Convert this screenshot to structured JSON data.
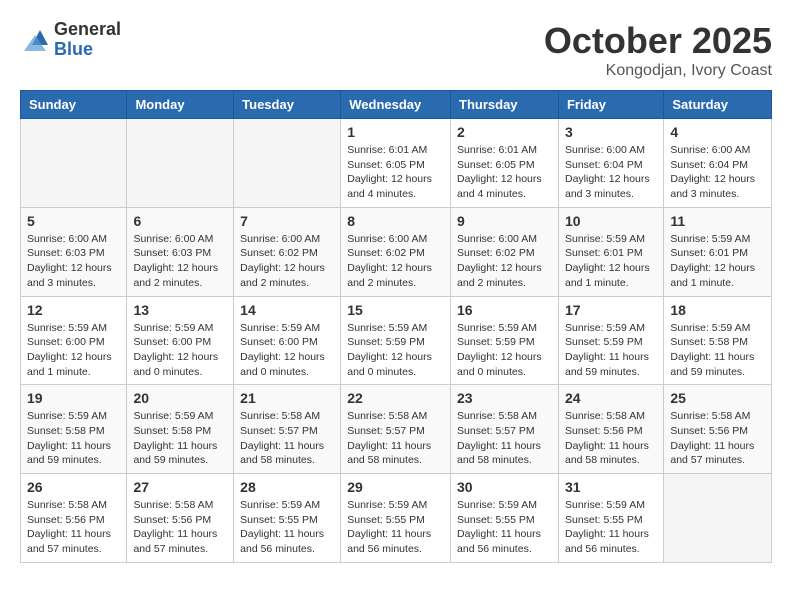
{
  "header": {
    "logo_general": "General",
    "logo_blue": "Blue",
    "month_title": "October 2025",
    "subtitle": "Kongodjan, Ivory Coast"
  },
  "days_of_week": [
    "Sunday",
    "Monday",
    "Tuesday",
    "Wednesday",
    "Thursday",
    "Friday",
    "Saturday"
  ],
  "weeks": [
    [
      {
        "day": "",
        "info": ""
      },
      {
        "day": "",
        "info": ""
      },
      {
        "day": "",
        "info": ""
      },
      {
        "day": "1",
        "info": "Sunrise: 6:01 AM\nSunset: 6:05 PM\nDaylight: 12 hours\nand 4 minutes."
      },
      {
        "day": "2",
        "info": "Sunrise: 6:01 AM\nSunset: 6:05 PM\nDaylight: 12 hours\nand 4 minutes."
      },
      {
        "day": "3",
        "info": "Sunrise: 6:00 AM\nSunset: 6:04 PM\nDaylight: 12 hours\nand 3 minutes."
      },
      {
        "day": "4",
        "info": "Sunrise: 6:00 AM\nSunset: 6:04 PM\nDaylight: 12 hours\nand 3 minutes."
      }
    ],
    [
      {
        "day": "5",
        "info": "Sunrise: 6:00 AM\nSunset: 6:03 PM\nDaylight: 12 hours\nand 3 minutes."
      },
      {
        "day": "6",
        "info": "Sunrise: 6:00 AM\nSunset: 6:03 PM\nDaylight: 12 hours\nand 2 minutes."
      },
      {
        "day": "7",
        "info": "Sunrise: 6:00 AM\nSunset: 6:02 PM\nDaylight: 12 hours\nand 2 minutes."
      },
      {
        "day": "8",
        "info": "Sunrise: 6:00 AM\nSunset: 6:02 PM\nDaylight: 12 hours\nand 2 minutes."
      },
      {
        "day": "9",
        "info": "Sunrise: 6:00 AM\nSunset: 6:02 PM\nDaylight: 12 hours\nand 2 minutes."
      },
      {
        "day": "10",
        "info": "Sunrise: 5:59 AM\nSunset: 6:01 PM\nDaylight: 12 hours\nand 1 minute."
      },
      {
        "day": "11",
        "info": "Sunrise: 5:59 AM\nSunset: 6:01 PM\nDaylight: 12 hours\nand 1 minute."
      }
    ],
    [
      {
        "day": "12",
        "info": "Sunrise: 5:59 AM\nSunset: 6:00 PM\nDaylight: 12 hours\nand 1 minute."
      },
      {
        "day": "13",
        "info": "Sunrise: 5:59 AM\nSunset: 6:00 PM\nDaylight: 12 hours\nand 0 minutes."
      },
      {
        "day": "14",
        "info": "Sunrise: 5:59 AM\nSunset: 6:00 PM\nDaylight: 12 hours\nand 0 minutes."
      },
      {
        "day": "15",
        "info": "Sunrise: 5:59 AM\nSunset: 5:59 PM\nDaylight: 12 hours\nand 0 minutes."
      },
      {
        "day": "16",
        "info": "Sunrise: 5:59 AM\nSunset: 5:59 PM\nDaylight: 12 hours\nand 0 minutes."
      },
      {
        "day": "17",
        "info": "Sunrise: 5:59 AM\nSunset: 5:59 PM\nDaylight: 11 hours\nand 59 minutes."
      },
      {
        "day": "18",
        "info": "Sunrise: 5:59 AM\nSunset: 5:58 PM\nDaylight: 11 hours\nand 59 minutes."
      }
    ],
    [
      {
        "day": "19",
        "info": "Sunrise: 5:59 AM\nSunset: 5:58 PM\nDaylight: 11 hours\nand 59 minutes."
      },
      {
        "day": "20",
        "info": "Sunrise: 5:59 AM\nSunset: 5:58 PM\nDaylight: 11 hours\nand 59 minutes."
      },
      {
        "day": "21",
        "info": "Sunrise: 5:58 AM\nSunset: 5:57 PM\nDaylight: 11 hours\nand 58 minutes."
      },
      {
        "day": "22",
        "info": "Sunrise: 5:58 AM\nSunset: 5:57 PM\nDaylight: 11 hours\nand 58 minutes."
      },
      {
        "day": "23",
        "info": "Sunrise: 5:58 AM\nSunset: 5:57 PM\nDaylight: 11 hours\nand 58 minutes."
      },
      {
        "day": "24",
        "info": "Sunrise: 5:58 AM\nSunset: 5:56 PM\nDaylight: 11 hours\nand 58 minutes."
      },
      {
        "day": "25",
        "info": "Sunrise: 5:58 AM\nSunset: 5:56 PM\nDaylight: 11 hours\nand 57 minutes."
      }
    ],
    [
      {
        "day": "26",
        "info": "Sunrise: 5:58 AM\nSunset: 5:56 PM\nDaylight: 11 hours\nand 57 minutes."
      },
      {
        "day": "27",
        "info": "Sunrise: 5:58 AM\nSunset: 5:56 PM\nDaylight: 11 hours\nand 57 minutes."
      },
      {
        "day": "28",
        "info": "Sunrise: 5:59 AM\nSunset: 5:55 PM\nDaylight: 11 hours\nand 56 minutes."
      },
      {
        "day": "29",
        "info": "Sunrise: 5:59 AM\nSunset: 5:55 PM\nDaylight: 11 hours\nand 56 minutes."
      },
      {
        "day": "30",
        "info": "Sunrise: 5:59 AM\nSunset: 5:55 PM\nDaylight: 11 hours\nand 56 minutes."
      },
      {
        "day": "31",
        "info": "Sunrise: 5:59 AM\nSunset: 5:55 PM\nDaylight: 11 hours\nand 56 minutes."
      },
      {
        "day": "",
        "info": ""
      }
    ]
  ]
}
